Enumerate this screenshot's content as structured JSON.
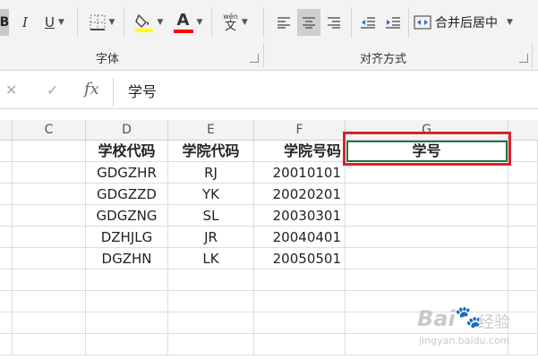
{
  "ribbon": {
    "bold_label": "B",
    "italic_label": "I",
    "underline_label": "U",
    "pinyin_top": "wén",
    "pinyin_bottom": "文",
    "font_color_letter": "A",
    "merge_label": "合并后居中",
    "groups": {
      "font": "字体",
      "alignment": "对齐方式"
    },
    "colors": {
      "highlight": "#ffff00",
      "font_color": "#ff0000"
    }
  },
  "formula_bar": {
    "fx_label": "fx",
    "value": "学号"
  },
  "columns": [
    "C",
    "D",
    "E",
    "F",
    "G"
  ],
  "sheet": {
    "header_row": [
      "学校代码",
      "学院代码",
      "学院号码",
      "学号"
    ],
    "rows": [
      [
        "GDGZHR",
        "RJ",
        "20010101"
      ],
      [
        "GDGZZD",
        "YK",
        "20020201"
      ],
      [
        "GDGZNG",
        "SL",
        "20030301"
      ],
      [
        "DZHJLG",
        "JR",
        "20040401"
      ],
      [
        "DGZHN",
        "LK",
        "20050501"
      ]
    ]
  },
  "watermark": {
    "brand": "Bai",
    "cn": "经验",
    "url": "jingyan.baidu.com"
  },
  "theme": {
    "selection_green": "#217346",
    "annotation_red": "#d9232d"
  }
}
